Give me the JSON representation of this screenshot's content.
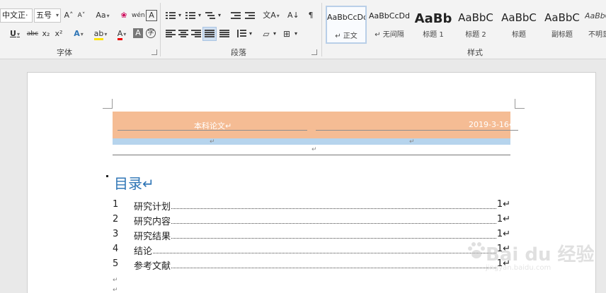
{
  "ribbon": {
    "font_group": {
      "label": "字体",
      "font_name": "中文正·",
      "font_size": "五号",
      "grow_font": "A˄",
      "shrink_font": "A˅",
      "change_case": "Aa",
      "clear_format": "❀",
      "phonetic": "wén",
      "char_border": "A",
      "underline": "U",
      "strikethrough": "abc",
      "subscript": "x₂",
      "superscript": "x²",
      "text_effect": "A",
      "highlight": "ab",
      "font_color": "A",
      "char_shading": "A",
      "enclose_char": "字"
    },
    "paragraph_group": {
      "label": "段落",
      "sort": "A↓",
      "show_marks": "¶",
      "chinese_layout": "文A"
    },
    "styles_group": {
      "label": "样式",
      "items": [
        {
          "sample": "AaBbCcDd",
          "name": "↵ 正文",
          "active": true
        },
        {
          "sample": "AaBbCcDd",
          "name": "↵ 无间隔",
          "active": false
        },
        {
          "sample": "AaBb",
          "name": "标题 1",
          "active": false
        },
        {
          "sample": "AaBbC",
          "name": "标题 2",
          "active": false
        },
        {
          "sample": "AaBbC",
          "name": "标题",
          "active": false
        },
        {
          "sample": "AaBbC",
          "name": "副标题",
          "active": false
        },
        {
          "sample": "AaBbCc",
          "name": "不明显",
          "active": false
        }
      ]
    }
  },
  "document": {
    "header_title": "本科论文↵",
    "header_date": "2019-3-16↵",
    "paragraph_mark": "↵",
    "toc_heading": "目录↵",
    "toc_entries": [
      {
        "num": "1",
        "title": "研究计划",
        "page": "1↵"
      },
      {
        "num": "2",
        "title": "研究内容",
        "page": "1↵"
      },
      {
        "num": "3",
        "title": "研究结果",
        "page": "1↵"
      },
      {
        "num": "4",
        "title": "结论",
        "page": "1↵"
      },
      {
        "num": "5",
        "title": "参考文献",
        "page": "1↵"
      }
    ]
  },
  "watermark": {
    "brand": "Bai du 经验",
    "url": "jingyan.baidu.com"
  }
}
